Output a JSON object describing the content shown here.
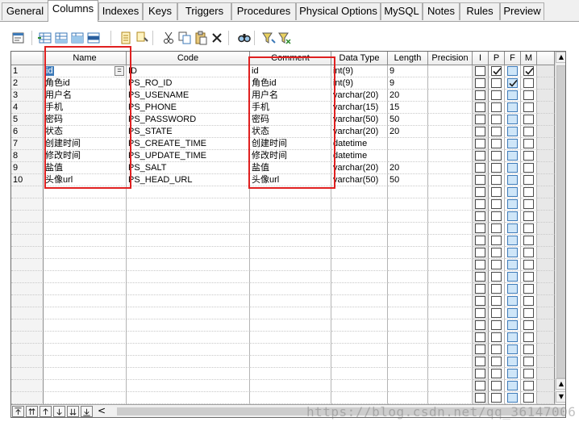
{
  "tabs": [
    "General",
    "Columns",
    "Indexes",
    "Keys",
    "Triggers",
    "Procedures",
    "Physical Options",
    "MySQL",
    "Notes",
    "Rules",
    "Preview"
  ],
  "active_tab": "Columns",
  "toolbar_icons": [
    "properties-icon",
    "insert-row-icon",
    "add-row-icon",
    "add-rows-icon",
    "delete-row-icon",
    "new-column-icon",
    "reference-icon",
    "cut-icon",
    "copy-icon",
    "paste-icon",
    "delete-icon",
    "find-icon",
    "filter-icon",
    "clear-filter-icon"
  ],
  "columns_header": {
    "name": "Name",
    "code": "Code",
    "comment": "Comment",
    "data_type": "Data Type",
    "length": "Length",
    "precision": "Precision",
    "i": "I",
    "p": "P",
    "f": "F",
    "m": "M"
  },
  "rows": [
    {
      "n": "1",
      "name": "id",
      "code": "ID",
      "comment": "id",
      "type": "int(9)",
      "length": "9",
      "i": false,
      "p": true,
      "f": false,
      "m": true
    },
    {
      "n": "2",
      "name": "角色id",
      "code": "PS_RO_ID",
      "comment": "角色id",
      "type": "int(9)",
      "length": "9",
      "i": false,
      "p": false,
      "f": true,
      "m": false
    },
    {
      "n": "3",
      "name": "用户名",
      "code": "PS_USENAME",
      "comment": "用户名",
      "type": "varchar(20)",
      "length": "20",
      "i": false,
      "p": false,
      "f": false,
      "m": false
    },
    {
      "n": "4",
      "name": "手机",
      "code": "PS_PHONE",
      "comment": "手机",
      "type": "varchar(15)",
      "length": "15",
      "i": false,
      "p": false,
      "f": false,
      "m": false
    },
    {
      "n": "5",
      "name": "密码",
      "code": "PS_PASSWORD",
      "comment": "密码",
      "type": "varchar(50)",
      "length": "50",
      "i": false,
      "p": false,
      "f": false,
      "m": false
    },
    {
      "n": "6",
      "name": "状态",
      "code": "PS_STATE",
      "comment": "状态",
      "type": "varchar(20)",
      "length": "20",
      "i": false,
      "p": false,
      "f": false,
      "m": false
    },
    {
      "n": "7",
      "name": "创建时间",
      "code": "PS_CREATE_TIME",
      "comment": "创建时间",
      "type": "datetime",
      "length": "",
      "i": false,
      "p": false,
      "f": false,
      "m": false
    },
    {
      "n": "8",
      "name": "修改时间",
      "code": "PS_UPDATE_TIME",
      "comment": "修改时间",
      "type": "datetime",
      "length": "",
      "i": false,
      "p": false,
      "f": false,
      "m": false
    },
    {
      "n": "9",
      "name": "盐值",
      "code": "PS_SALT",
      "comment": "盐值",
      "type": "varchar(20)",
      "length": "20",
      "i": false,
      "p": false,
      "f": false,
      "m": false
    },
    {
      "n": "10",
      "name": "头像url",
      "code": "PS_HEAD_URL",
      "comment": "头像url",
      "type": "varchar(50)",
      "length": "50",
      "i": false,
      "p": false,
      "f": false,
      "m": false
    }
  ],
  "empty_row_count": 18,
  "ellipsis_label": "=",
  "nav_icons": [
    "move-top-icon",
    "move-up-page-icon",
    "move-up-icon",
    "move-down-icon",
    "move-down-page-icon",
    "move-bottom-icon"
  ],
  "scroll_left_label": "<",
  "watermark": "https://blog.csdn.net/qq_36147006",
  "colors": {
    "annotation_red": "#e02020",
    "selection_blue": "#3d7ab8",
    "checkbox_blue_fill": "#cfe6f8",
    "header_gray": "#ececec"
  }
}
